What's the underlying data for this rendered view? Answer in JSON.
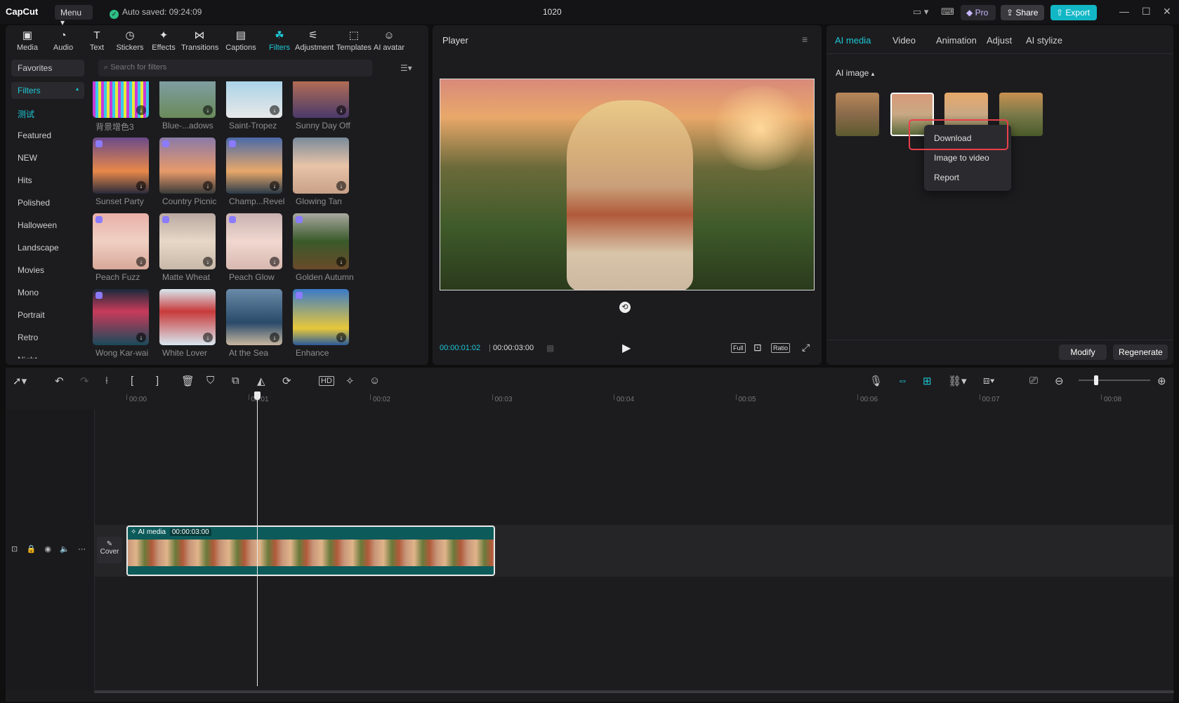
{
  "app": {
    "logo": "CapCut",
    "menu": "Menu",
    "auto_saved": "Auto saved: 09:24:09",
    "project_title": "1020"
  },
  "titlebar": {
    "pro": "Pro",
    "share": "Share",
    "export": "Export"
  },
  "toolbar": [
    {
      "label": "Media",
      "icon": "media-icon"
    },
    {
      "label": "Audio",
      "icon": "audio-icon"
    },
    {
      "label": "Text",
      "icon": "text-icon"
    },
    {
      "label": "Stickers",
      "icon": "stickers-icon"
    },
    {
      "label": "Effects",
      "icon": "effects-icon"
    },
    {
      "label": "Transitions",
      "icon": "transitions-icon"
    },
    {
      "label": "Captions",
      "icon": "captions-icon"
    },
    {
      "label": "Filters",
      "icon": "filters-icon",
      "active": true
    },
    {
      "label": "Adjustment",
      "icon": "adjustment-icon"
    },
    {
      "label": "Templates",
      "icon": "templates-icon"
    },
    {
      "label": "AI avatar",
      "icon": "ai-avatar-icon"
    }
  ],
  "categories": [
    "Favorites",
    "Filters",
    "测试",
    "Featured",
    "NEW",
    "Hits",
    "Polished",
    "Halloween",
    "Landscape",
    "Movies",
    "Mono",
    "Portrait",
    "Retro",
    "Night"
  ],
  "search": {
    "placeholder": "Search for filters"
  },
  "filters": [
    [
      "背景增色3",
      "Blue-...adows",
      "Saint-Tropez",
      "Sunny Day Off"
    ],
    [
      "Sunset Party",
      "Country Picnic",
      "Champ...Revel",
      "Glowing Tan"
    ],
    [
      "Peach Fuzz",
      "Matte Wheat",
      "Peach Glow",
      "Golden Autumn"
    ],
    [
      "Wong Kar-wai",
      "White Lover",
      "At the Sea",
      "Enhance"
    ]
  ],
  "player": {
    "title": "Player",
    "current_time": "00:00:01:02",
    "total_time": "00:00:03:00",
    "btn_full": "Full",
    "btn_ratio": "Ratio"
  },
  "right_panel": {
    "tabs": [
      "AI media",
      "Video",
      "Animation",
      "Adjust",
      "AI stylize"
    ],
    "section": "AI image",
    "context_menu": [
      "Download",
      "Image to video",
      "Report"
    ],
    "modify": "Modify",
    "regenerate": "Regenerate"
  },
  "timeline": {
    "ticks": [
      "00:00",
      "00:01",
      "00:02",
      "00:03",
      "00:04",
      "00:05",
      "00:06",
      "00:07",
      "00:08"
    ],
    "clip_label": "AI media",
    "clip_duration": "00:00:03:00",
    "cover": "Cover"
  },
  "colors": {
    "accent": "#1ec8d6",
    "highlight": "#e8404a",
    "clip": "#0d5a5a"
  }
}
